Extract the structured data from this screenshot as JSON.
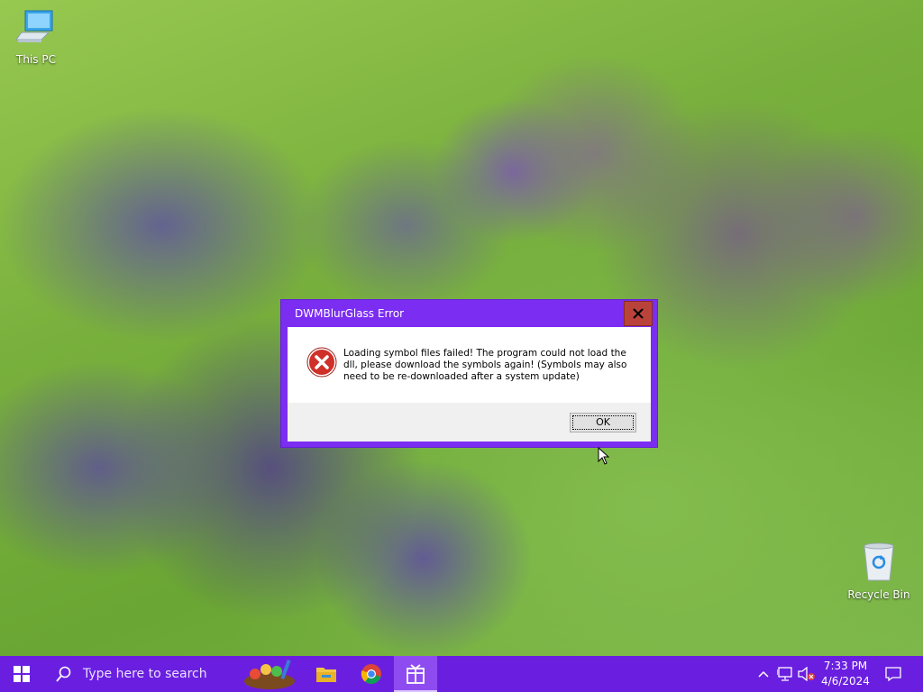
{
  "desktop": {
    "icons": [
      {
        "label": "This PC"
      },
      {
        "label": "Recycle Bin"
      }
    ]
  },
  "dialog": {
    "title": "DWMBlurGlass Error",
    "message": "Loading symbol files failed! The program could not load the dll, please download the symbols again! (Symbols may also need to be re-downloaded after a system update)",
    "ok_label": "OK",
    "close_symbol": "✕",
    "icon": "error-icon"
  },
  "taskbar": {
    "search_placeholder": "Type here to search",
    "apps": [
      "paint-app-icon",
      "file-explorer-icon",
      "chrome-icon",
      "app-icon"
    ],
    "tray": [
      "show-hidden-icons",
      "network-icon",
      "volume-muted-icon"
    ],
    "time": "7:33 PM",
    "date": "4/6/2024"
  },
  "colors": {
    "taskbar": "#6a1fe0",
    "dialog_frame": "#7b2df2",
    "close_button": "#b9433b",
    "error_red": "#d0302a"
  }
}
